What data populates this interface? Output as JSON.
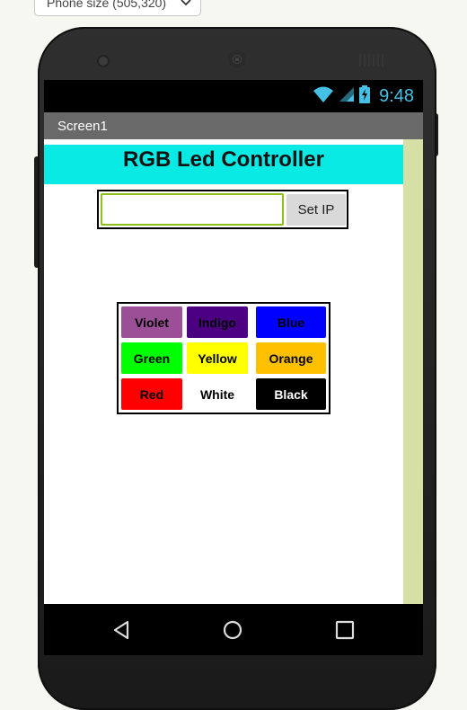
{
  "top_select": {
    "value": "Phone size (505,320)",
    "chevron": "chevron-down-icon"
  },
  "status_bar": {
    "time": "9:48",
    "icons": [
      "wifi-icon",
      "signal-icon",
      "battery-charging-icon"
    ],
    "color": "#45c1e6"
  },
  "app": {
    "screen_title": "Screen1",
    "heading": "RGB Led Controller",
    "heading_bg": "#0aeae4",
    "ip": {
      "value": "",
      "placeholder": "",
      "button_label": "Set IP"
    },
    "color_buttons": [
      {
        "label": "Violet",
        "bg": "#9b4f96",
        "fg": "#000000"
      },
      {
        "label": "Indigo",
        "bg": "#4b0082",
        "fg": "#000000"
      },
      {
        "label": "Blue",
        "bg": "#0000ff",
        "fg": "#000000"
      },
      {
        "label": "Green",
        "bg": "#00ff00",
        "fg": "#000000"
      },
      {
        "label": "Yellow",
        "bg": "#ffff00",
        "fg": "#000000"
      },
      {
        "label": "Orange",
        "bg": "#ffc000",
        "fg": "#000000"
      },
      {
        "label": "Red",
        "bg": "#ff0000",
        "fg": "#000000"
      },
      {
        "label": "White",
        "bg": "#ffffff",
        "fg": "#000000"
      },
      {
        "label": "Black",
        "bg": "#000000",
        "fg": "#ffffff"
      }
    ]
  },
  "nav_bar": {
    "icons": [
      "back-icon",
      "home-icon",
      "recent-apps-icon"
    ]
  }
}
